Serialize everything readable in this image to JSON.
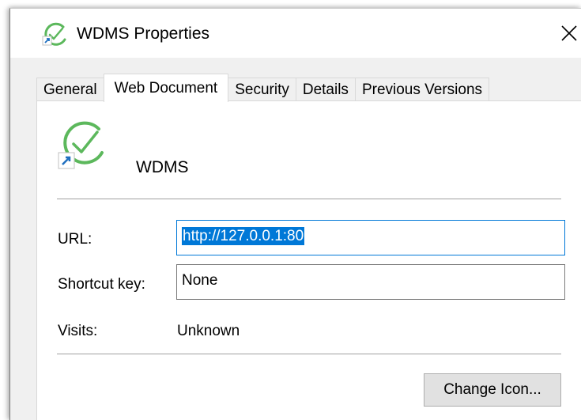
{
  "window": {
    "title": "WDMS Properties"
  },
  "tabs": [
    {
      "label": "General"
    },
    {
      "label": "Web Document"
    },
    {
      "label": "Security"
    },
    {
      "label": "Details"
    },
    {
      "label": "Previous Versions"
    }
  ],
  "panel": {
    "name": "WDMS",
    "url_label": "URL:",
    "url_value": "http://127.0.0.1:80",
    "shortcut_label": "Shortcut key:",
    "shortcut_value": "None",
    "visits_label": "Visits:",
    "visits_value": "Unknown",
    "change_icon_label": "Change Icon..."
  },
  "icons": {
    "app": "check-circle-icon",
    "shortcut_overlay": "shortcut-arrow-icon",
    "close": "close-icon"
  },
  "colors": {
    "accent": "#0078d7",
    "icon_green": "#5cb85c"
  }
}
